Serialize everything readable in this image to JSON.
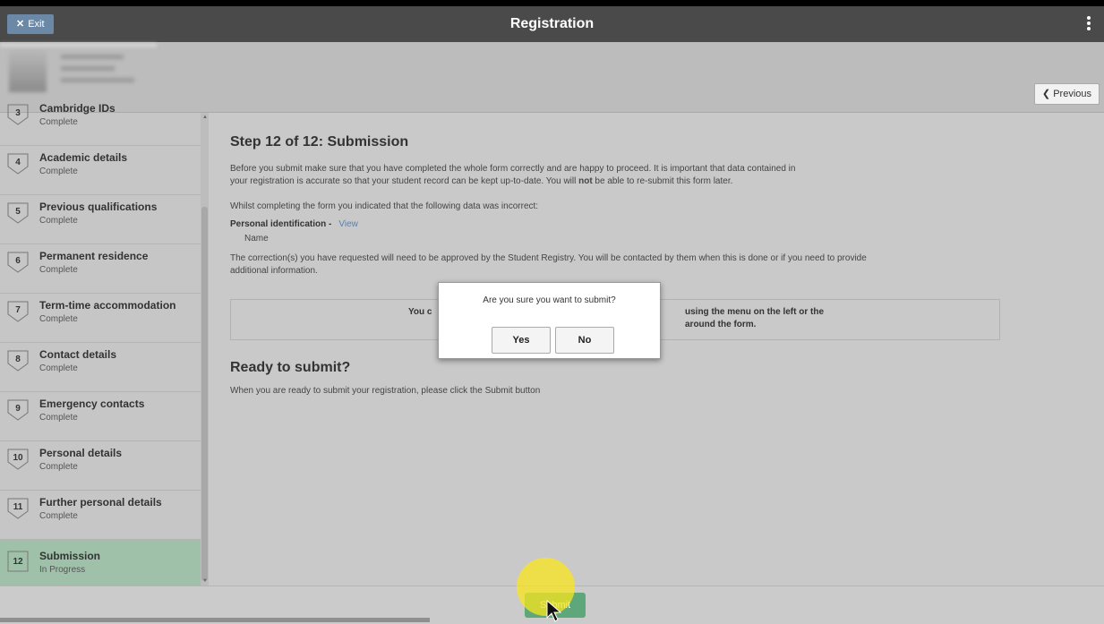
{
  "header": {
    "exit_label": "Exit",
    "title": "Registration"
  },
  "nav": {
    "previous_label": "Previous"
  },
  "steps": [
    {
      "num": "3",
      "title": "Cambridge IDs",
      "status": "Complete"
    },
    {
      "num": "4",
      "title": "Academic details",
      "status": "Complete"
    },
    {
      "num": "5",
      "title": "Previous qualifications",
      "status": "Complete"
    },
    {
      "num": "6",
      "title": "Permanent residence",
      "status": "Complete"
    },
    {
      "num": "7",
      "title": "Term-time accommodation",
      "status": "Complete"
    },
    {
      "num": "8",
      "title": "Contact details",
      "status": "Complete"
    },
    {
      "num": "9",
      "title": "Emergency contacts",
      "status": "Complete"
    },
    {
      "num": "10",
      "title": "Personal details",
      "status": "Complete"
    },
    {
      "num": "11",
      "title": "Further personal details",
      "status": "Complete"
    },
    {
      "num": "12",
      "title": "Submission",
      "status": "In Progress"
    }
  ],
  "main": {
    "heading": "Step 12 of 12: Submission",
    "intro_line1": "Before you submit make sure that you have completed the whole form correctly and are happy to proceed. It is important that data contained in",
    "intro_line2_a": "your registration is accurate so that your student record can be kept up-to-date. You will ",
    "intro_line2_bold": "not",
    "intro_line2_b": " be able to re-submit this form later.",
    "incorrect_note": "Whilst completing the form you indicated that the following data was incorrect:",
    "personal_id_label": "Personal identification -",
    "view_link": "View",
    "incorrect_item": "Name",
    "correction_line1": "The correction(s) you have requested will need to be approved by the Student Registry. You will be contacted by them when this is done or if you need to provide",
    "correction_line2": "additional information.",
    "infobox_left": "You c",
    "infobox_right1": "using the menu on the left or the",
    "infobox_right2": "around the form.",
    "ready_heading": "Ready to submit?",
    "ready_text": "When you are ready to submit your registration, please click the Submit button"
  },
  "footer": {
    "submit_label": "Submit"
  },
  "dialog": {
    "message": "Are you sure you want to submit?",
    "yes_label": "Yes",
    "no_label": "No"
  },
  "colors": {
    "topbar": "#4a4a4a",
    "exit_button": "#6b88a6",
    "current_step": "#9fc0a9",
    "submit_button": "#5ea77a",
    "link": "#5a80b0"
  }
}
